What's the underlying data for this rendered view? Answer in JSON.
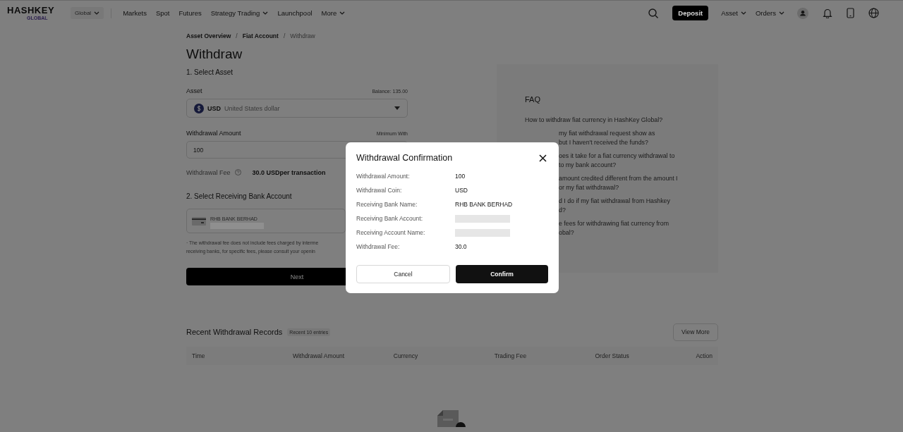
{
  "header": {
    "logo_top": "HASHKEY",
    "logo_bottom": "GLOBAL",
    "region": "Global",
    "nav": [
      {
        "label": "Markets",
        "dropdown": false
      },
      {
        "label": "Spot",
        "dropdown": false
      },
      {
        "label": "Futures",
        "dropdown": false
      },
      {
        "label": "Strategy Trading",
        "dropdown": true
      },
      {
        "label": "Launchpool",
        "dropdown": false
      },
      {
        "label": "More",
        "dropdown": true
      }
    ],
    "deposit": "Deposit",
    "menus": [
      {
        "label": "Asset",
        "dropdown": true
      },
      {
        "label": "Orders",
        "dropdown": true
      }
    ]
  },
  "breadcrumb": [
    {
      "label": "Asset Overview",
      "current": false
    },
    {
      "separator": "/",
      "label": "Fiat Account",
      "current": false
    },
    {
      "separator": "/",
      "label": "Withdraw",
      "current": true
    }
  ],
  "title": "Withdraw",
  "step1": {
    "heading": "1. Select Asset",
    "asset_label": "Asset",
    "balance": "Balance: 135.00",
    "asset_code": "USD",
    "asset_name": "United States dollar",
    "amount_label": "Withdrawal Amount",
    "minimum": "Minimum With",
    "amount_value": "100",
    "fee_label": "Withdrawal Fee",
    "fee_value": "30.0 USDper transaction"
  },
  "step2": {
    "heading": "2. Select Receiving Bank Account",
    "bank_name": "RHB BANK BERHAD",
    "note": [
      "· The withdrawal fee does not include fees charged by interme",
      "receiving banks, for specific fees, please consult your openin"
    ]
  },
  "next": "Next",
  "faq": {
    "title": "FAQ",
    "items": [
      {
        "kind": "whole",
        "lines": [
          "How to withdraw fiat currency in HashKey Global?"
        ]
      },
      {
        "kind": "cut",
        "lines": [
          "my fiat withdrawal request show as",
          "but I haven't received the funds?"
        ]
      },
      {
        "kind": "cut",
        "lines": [
          "oes it take for a fiat currency withdrawal to",
          "to my bank account?"
        ]
      },
      {
        "kind": "cut",
        "lines": [
          "amount credited different from the amount I",
          "or my fiat withdrawal?"
        ]
      },
      {
        "kind": "cut",
        "lines": [
          "d I do if my fiat withdrawal from Hashkey",
          "d?"
        ]
      },
      {
        "kind": "cut",
        "lines": [
          "e fees for withdrawing fiat currency from",
          "obal?"
        ]
      }
    ]
  },
  "records": {
    "title": "Recent Withdrawal Records",
    "badge": "Recent 10 entries",
    "view_more": "View More",
    "columns": [
      "Time",
      "Withdrawal Amount",
      "Currency",
      "Trading Fee",
      "Order Status",
      "Action"
    ]
  },
  "modal": {
    "title": "Withdrawal Confirmation",
    "rows": [
      {
        "label": "Withdrawal Amount:",
        "kind": "text",
        "value": "100"
      },
      {
        "label": "Withdrawal Coin:",
        "kind": "text",
        "value": "USD"
      },
      {
        "label": "Receiving Bank Name:",
        "kind": "text",
        "value": "RHB BANK BERHAD"
      },
      {
        "label": "Receiving Bank Account:",
        "kind": "redacted"
      },
      {
        "label": "Receiving Account Name:",
        "kind": "redacted"
      },
      {
        "label": "Withdrawal Fee:",
        "kind": "text",
        "value": "30.0"
      }
    ],
    "cancel": "Cancel",
    "confirm": "Confirm"
  }
}
